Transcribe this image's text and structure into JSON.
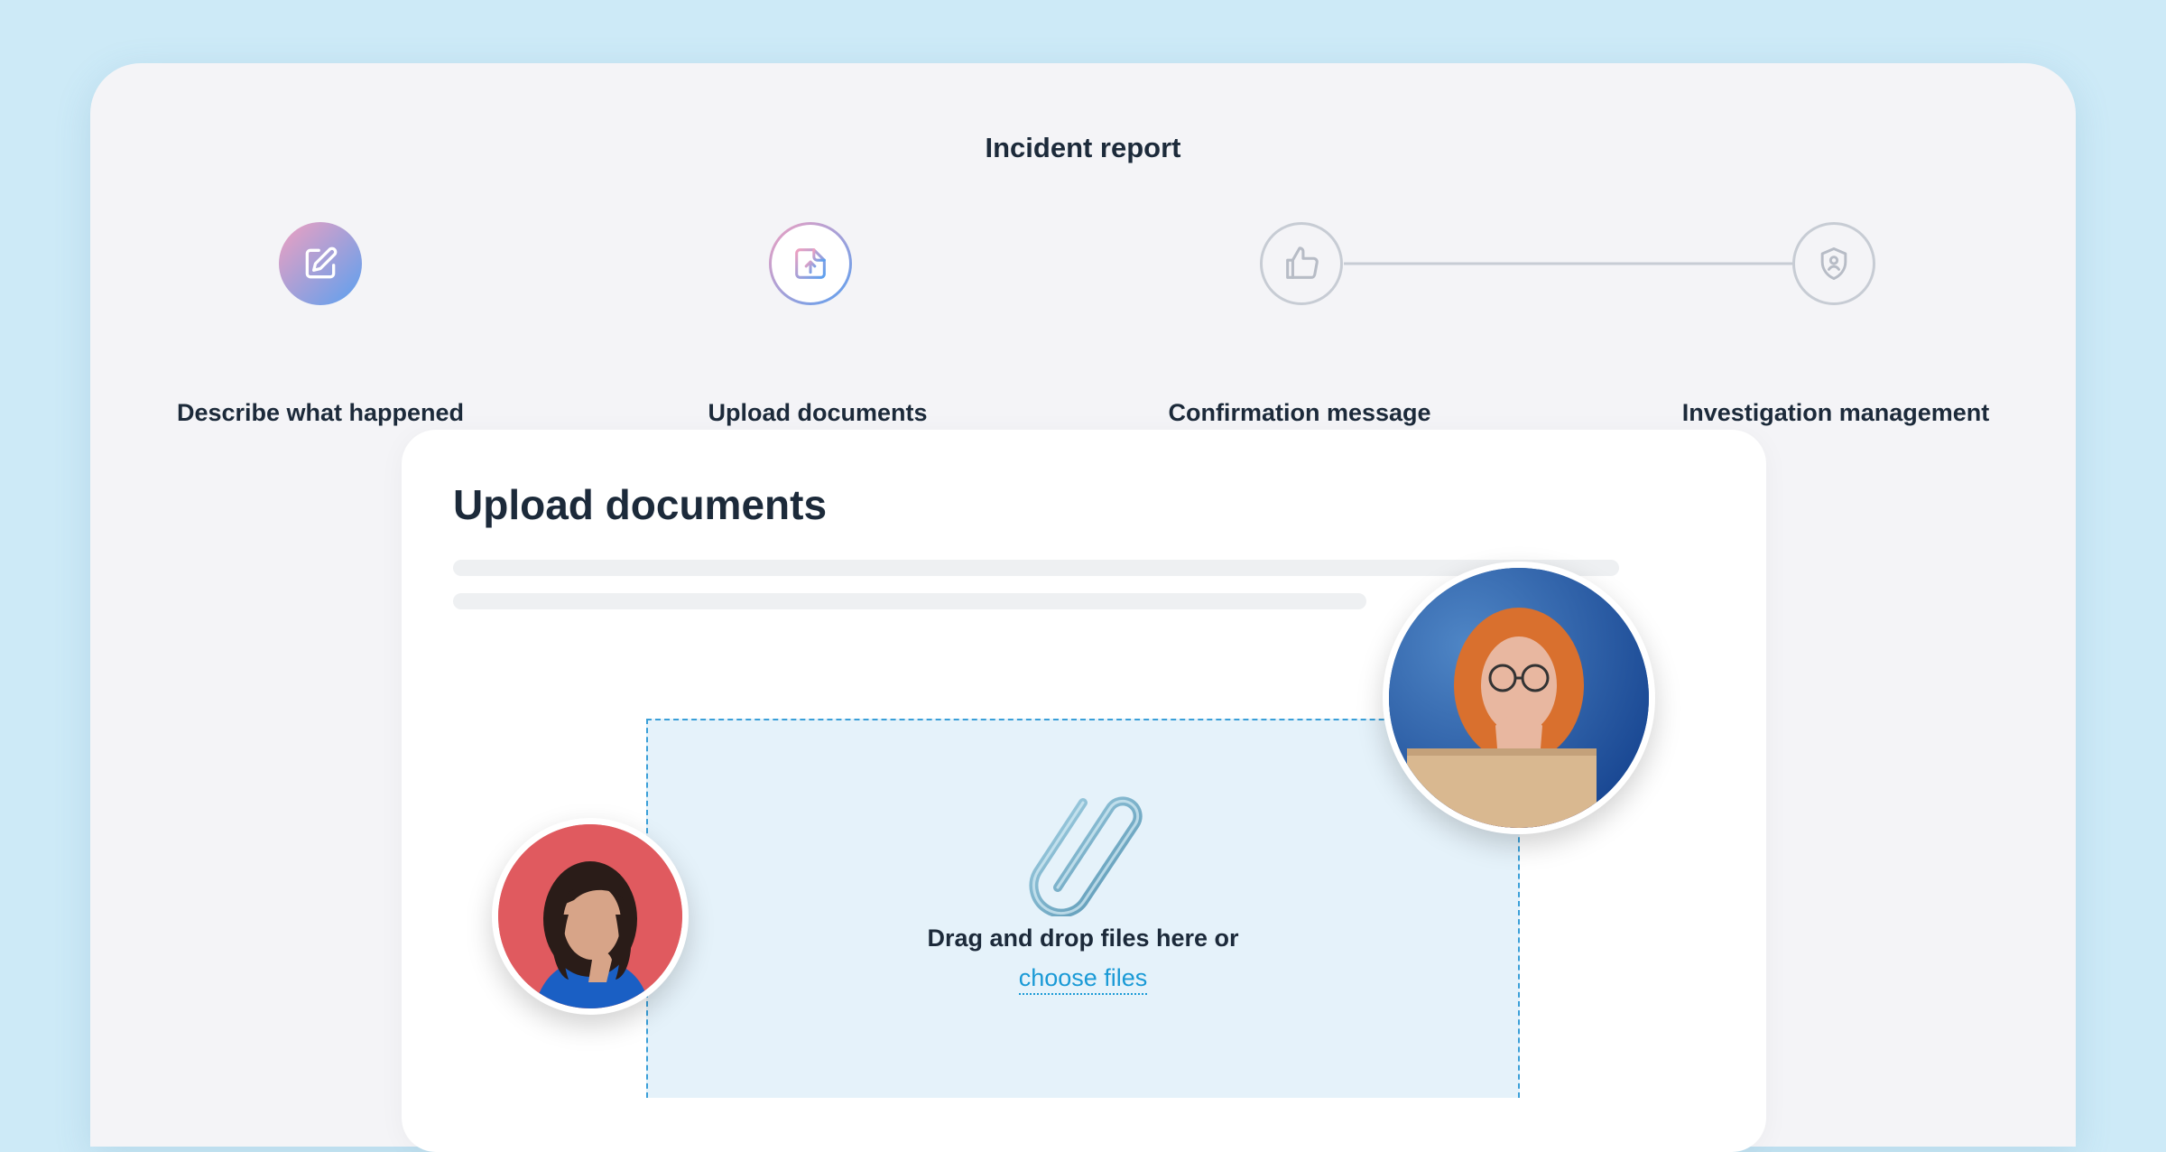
{
  "page": {
    "title": "Incident report"
  },
  "steps": [
    {
      "label": "Describe what happened",
      "state": "done",
      "icon": "edit-icon"
    },
    {
      "label": "Upload documents",
      "state": "active",
      "icon": "file-upload-icon"
    },
    {
      "label": "Confirmation message",
      "state": "todo",
      "icon": "thumbs-up-icon"
    },
    {
      "label": "Investigation management",
      "state": "todo",
      "icon": "shield-user-icon"
    }
  ],
  "card": {
    "title": "Upload documents",
    "dropzone": {
      "text": "Drag and drop files here or",
      "link": "choose files",
      "icon": "paperclip-icon"
    }
  },
  "colors": {
    "accent": "#1a9ad6",
    "gradient_start": "#f0a0c0",
    "gradient_end": "#5aa0f0",
    "inactive": "#c7ccd4"
  }
}
